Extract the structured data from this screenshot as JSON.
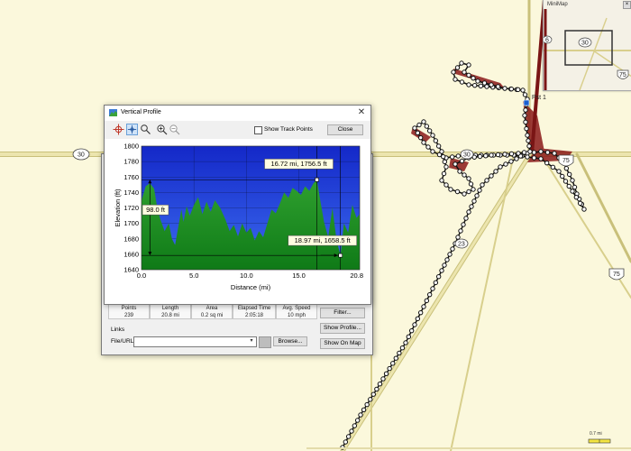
{
  "map": {
    "colors": {
      "background": "#fbf8dc",
      "road": "#e9e1a2",
      "road_edge": "#c9c07a",
      "track": "#111111",
      "highlight": "#8b1a1a"
    },
    "shields": [
      "30",
      "23",
      "75",
      "75",
      "30"
    ],
    "poi_label": "Pst 1"
  },
  "minimap": {
    "title": "MiniMap",
    "close_label": "×",
    "shields": [
      "6",
      "30",
      "75"
    ]
  },
  "vertical_profile": {
    "title": "Vertical Profile",
    "close_x": "✕",
    "show_track_points_label": "Show Track Points",
    "close_button": "Close",
    "toolbar_icons": [
      "crosshair-icon",
      "move-cursor-icon",
      "zoom-rectangle-icon",
      "zoom-in-icon",
      "zoom-out-icon"
    ]
  },
  "chart_data": {
    "type": "area",
    "xlabel": "Distance   (mi)",
    "ylabel": "Elevation (ft)",
    "xlim": [
      0,
      20.8
    ],
    "ylim": [
      1640,
      1800
    ],
    "x_ticks": [
      "0.0",
      "5.0",
      "10.0",
      "15.0",
      "20.8"
    ],
    "y_ticks": [
      "1640",
      "1660",
      "1680",
      "1700",
      "1720",
      "1740",
      "1760",
      "1780",
      "1800"
    ],
    "x": [
      0,
      0.4,
      0.8,
      1.2,
      1.5,
      1.8,
      2.2,
      2.6,
      2.9,
      3.2,
      3.5,
      3.8,
      4.0,
      4.3,
      4.6,
      5.0,
      5.4,
      5.8,
      6.2,
      6.6,
      7.0,
      7.5,
      8.0,
      8.4,
      8.8,
      9.2,
      9.6,
      10.0,
      10.4,
      10.8,
      11.2,
      11.6,
      12.0,
      12.4,
      12.8,
      13.2,
      13.6,
      14.0,
      14.4,
      14.8,
      15.2,
      15.6,
      16.0,
      16.4,
      16.72,
      17.0,
      17.4,
      17.8,
      18.2,
      18.6,
      18.97,
      19.3,
      19.7,
      20.1,
      20.5,
      20.8
    ],
    "y": [
      1730,
      1748,
      1752,
      1745,
      1720,
      1705,
      1690,
      1700,
      1680,
      1672,
      1695,
      1718,
      1702,
      1722,
      1710,
      1724,
      1734,
      1712,
      1728,
      1715,
      1730,
      1720,
      1705,
      1690,
      1698,
      1683,
      1700,
      1688,
      1694,
      1678,
      1690,
      1682,
      1700,
      1718,
      1713,
      1726,
      1740,
      1733,
      1746,
      1742,
      1737,
      1748,
      1742,
      1752,
      1756.5,
      1733,
      1702,
      1682,
      1720,
      1678,
      1658.5,
      1700,
      1688,
      1724,
      1707,
      1712
    ],
    "annotations": [
      {
        "text": "16.72 mi, 1756.5 ft",
        "x": 16.72,
        "y": 1756.5
      },
      {
        "text": "18.97 mi, 1658.5 ft",
        "x": 18.97,
        "y": 1658.5
      },
      {
        "text": "98.0 ft",
        "x": 0.8,
        "y_from": 1658.5,
        "y_to": 1756.5
      }
    ],
    "grid": true,
    "colors": {
      "sky_top": "#1428c8",
      "sky_bottom": "#3c6cf0",
      "fill_top": "#2fa02f",
      "fill_bottom": "#0f7a17"
    }
  },
  "properties": {
    "stats": [
      {
        "header": "Points",
        "value": "239"
      },
      {
        "header": "Length",
        "value": "20.8 mi"
      },
      {
        "header": "Area",
        "value": "0.2 sq mi"
      },
      {
        "header": "Elapsed Time",
        "value": "2:05:18"
      },
      {
        "header": "Avg. Speed",
        "value": "10 mph"
      }
    ],
    "filter_button": "Filter...",
    "show_profile_button": "Show Profile...",
    "show_on_map_button": "Show On Map",
    "links_label": "Links",
    "file_url_label": "File/URL:",
    "file_url_value": "",
    "browse_button": "Browse..."
  },
  "scale": {
    "label": "0.7 mi"
  }
}
